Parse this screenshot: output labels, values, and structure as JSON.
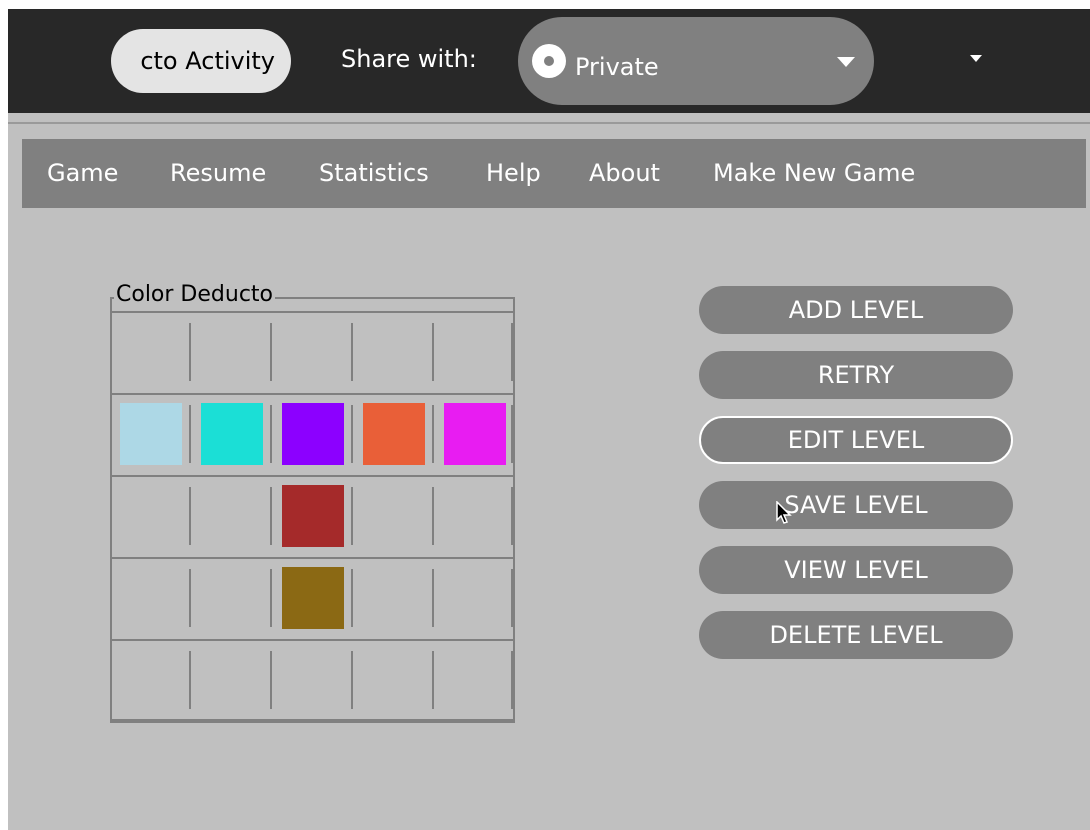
{
  "toolbar": {
    "activity_title": "cto Activity",
    "share_label": "Share with:",
    "share_value": "Private",
    "share_icon": "radio-icon",
    "combo_icon": "chevron-down-icon",
    "more_icon": "chevron-down-icon"
  },
  "menu": {
    "items": [
      "Game",
      "Resume",
      "Statistics",
      "Help",
      "About",
      "Make New Game"
    ]
  },
  "board": {
    "title": "Color Deducto",
    "rows": 5,
    "columns": 5,
    "cells": [
      [
        null,
        null,
        null,
        null,
        null
      ],
      [
        "#add8e6",
        "#1bdfd6",
        "#8c00ff",
        "#e95f38",
        "#e81cf2"
      ],
      [
        null,
        null,
        "#a52a2a",
        null,
        null
      ],
      [
        null,
        null,
        "#8b6914",
        null,
        null
      ],
      [
        null,
        null,
        null,
        null,
        null
      ]
    ]
  },
  "buttons": {
    "add_level": "ADD LEVEL",
    "retry": "RETRY",
    "edit_level": "EDIT LEVEL",
    "save_level": "SAVE LEVEL",
    "view_level": "VIEW LEVEL",
    "delete_level": "DELETE LEVEL"
  },
  "colors": {
    "toolbar_bg": "#282828",
    "canvas_bg": "#c0c0c0",
    "button_bg": "#808080",
    "text_light": "#ffffff"
  }
}
